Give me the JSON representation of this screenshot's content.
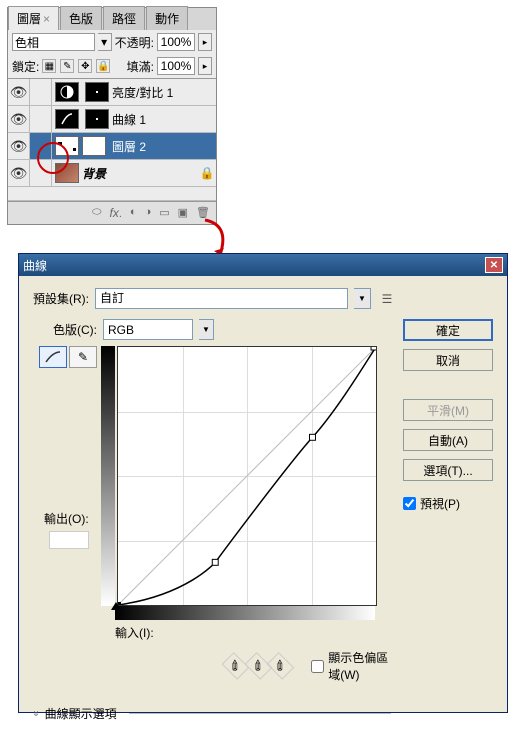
{
  "layers_panel": {
    "tabs": [
      "圖層",
      "色版",
      "路徑",
      "動作"
    ],
    "active_tab": 0,
    "blend_mode": "色相",
    "opacity_label": "不透明:",
    "opacity_value": "100%",
    "lock_label": "鎖定:",
    "fill_label": "填滿:",
    "fill_value": "100%",
    "layers": [
      {
        "name": "亮度/對比 1",
        "selected": false,
        "type": "adj"
      },
      {
        "name": "曲線 1",
        "selected": false,
        "type": "adj"
      },
      {
        "name": "圖層 2",
        "selected": true,
        "type": "adj"
      },
      {
        "name": "背景",
        "selected": false,
        "type": "bg"
      }
    ]
  },
  "curves_dialog": {
    "title": "曲線",
    "preset_label": "預設集(R):",
    "preset_value": "自訂",
    "channel_label": "色版(C):",
    "channel_value": "RGB",
    "output_label": "輸出(O):",
    "input_label": "輸入(I):",
    "clip_label": "顯示色偏區域(W)",
    "more_label": "曲線顯示選項",
    "buttons": {
      "ok": "確定",
      "cancel": "取消",
      "smooth": "平滑(M)",
      "auto": "自動(A)",
      "options": "選項(T)...",
      "preview": "預視(P)"
    }
  },
  "chart_data": {
    "type": "line",
    "title": "",
    "xlabel": "輸入",
    "ylabel": "輸出",
    "xlim": [
      0,
      255
    ],
    "ylim": [
      0,
      255
    ],
    "series": [
      {
        "name": "baseline",
        "x": [
          0,
          255
        ],
        "y": [
          0,
          255
        ]
      },
      {
        "name": "curve",
        "x": [
          0,
          96,
          192,
          255
        ],
        "y": [
          0,
          42,
          166,
          255
        ]
      }
    ]
  }
}
